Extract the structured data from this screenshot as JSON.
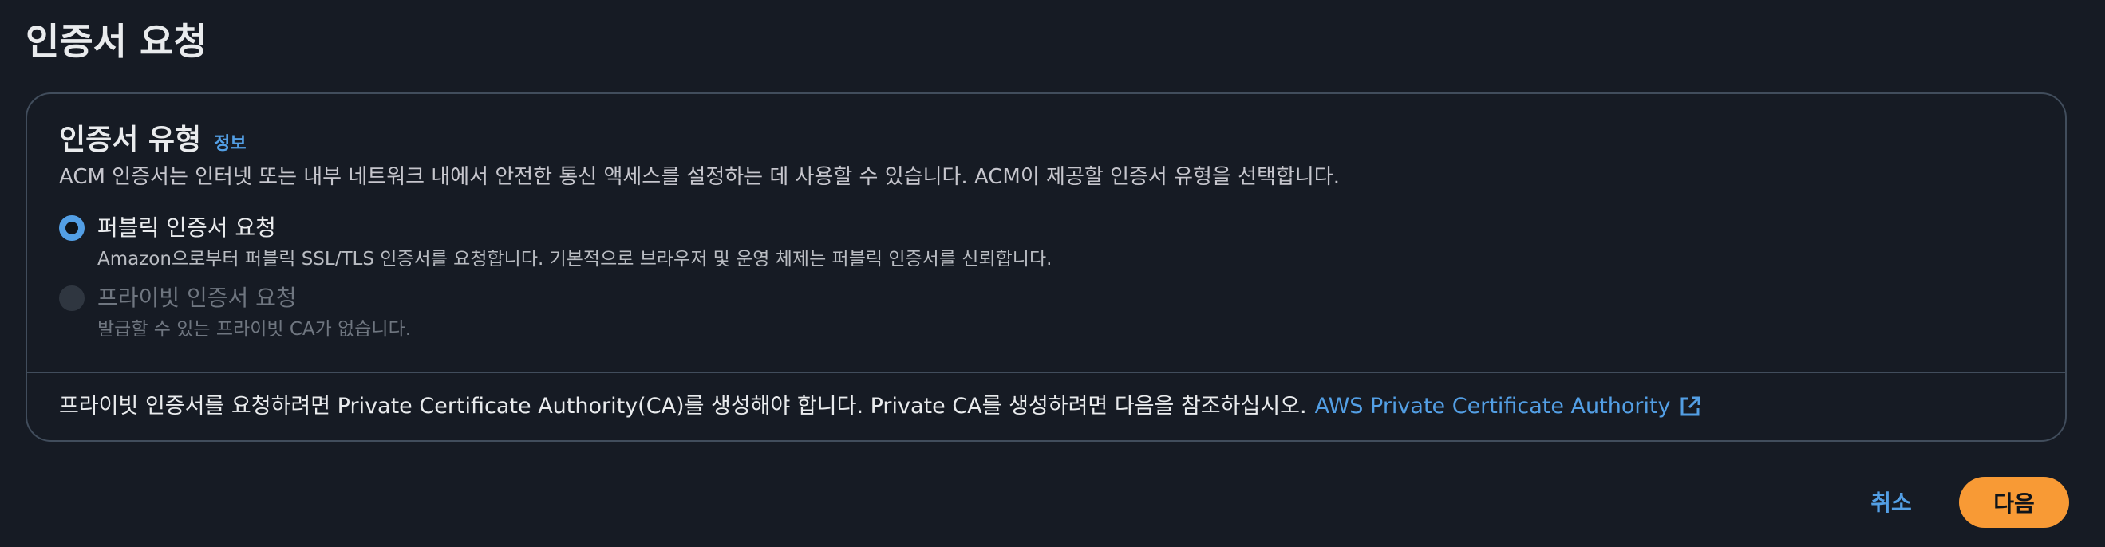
{
  "page": {
    "title": "인증서 요청"
  },
  "cert_type": {
    "title": "인증서 유형",
    "info_label": "정보",
    "description": "ACM 인증서는 인터넷 또는 내부 네트워크 내에서 안전한 통신 액세스를 설정하는 데 사용할 수 있습니다. ACM이 제공할 인증서 유형을 선택합니다.",
    "options": [
      {
        "label": "퍼블릭 인증서 요청",
        "description": "Amazon으로부터 퍼블릭 SSL/TLS 인증서를 요청합니다. 기본적으로 브라우저 및 운영 체제는 퍼블릭 인증서를 신뢰합니다.",
        "selected": true,
        "disabled": false
      },
      {
        "label": "프라이빗 인증서 요청",
        "description": "발급할 수 있는 프라이빗 CA가 없습니다.",
        "selected": false,
        "disabled": true
      }
    ],
    "footer_note": "프라이빗 인증서를 요청하려면 Private Certificate Authority(CA)를 생성해야 합니다. Private CA를 생성하려면 다음을 참조하십시오.",
    "footer_link": "AWS Private Certificate Authority"
  },
  "actions": {
    "cancel_label": "취소",
    "next_label": "다음"
  },
  "colors": {
    "background": "#161b24",
    "link": "#539fe5",
    "primary_button": "#f89a35",
    "border": "#414d5c"
  }
}
